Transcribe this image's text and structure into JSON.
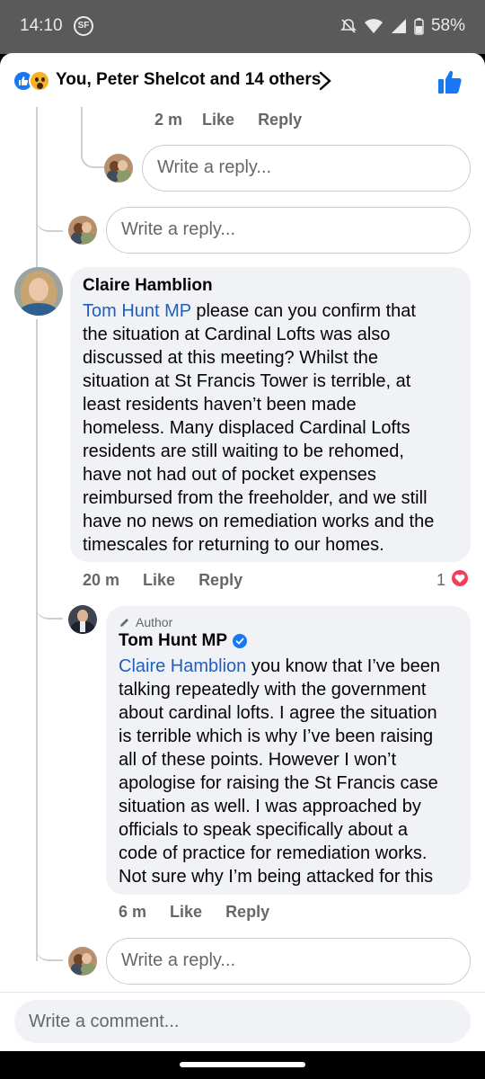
{
  "status_bar": {
    "time": "14:10",
    "sf_badge": "SF",
    "battery": "58%"
  },
  "reactions": {
    "summary": "You, Peter Shelcot and 14 others"
  },
  "thread_top": {
    "time": "2 m",
    "like": "Like",
    "reply": "Reply"
  },
  "reply_boxes": {
    "placeholder": "Write a reply..."
  },
  "comment_claire": {
    "author": "Claire Hamblion",
    "mention": "Tom Hunt MP",
    "lines": [
      "please can you confirm that",
      "the situation at Cardinal Lofts was also",
      "discussed at this meeting? Whilst the",
      "situation at St Francis Tower is terrible, at",
      "least residents haven’t been made",
      "homeless. Many displaced Cardinal Lofts",
      "residents are still waiting to be rehomed,",
      "have not had out of pocket expenses",
      "reimbursed from the freeholder, and we still",
      "have no news on remediation works and the",
      "timescales for returning to our homes."
    ],
    "time": "20 m",
    "like": "Like",
    "reply": "Reply",
    "reaction_count": "1"
  },
  "comment_tom": {
    "badge": "Author",
    "author": "Tom Hunt MP",
    "mention": "Claire Hamblion",
    "lines": [
      "you know that I’ve been",
      "talking repeatedly with the government",
      "about cardinal lofts. I agree the situation",
      "is terrible which is why I’ve been raising",
      "all of these points. However I won’t",
      "apologise for raising the St Francis case",
      "situation as well. I was approached by",
      "officials to speak specifically about a",
      "code of practice for remediation works.",
      "Not sure why I’m being attacked for this"
    ],
    "time": "6 m",
    "like": "Like",
    "reply": "Reply"
  },
  "composer": {
    "placeholder": "Write a comment..."
  },
  "colors": {
    "link": "#1f5fc1",
    "like_blue": "#1877f2",
    "heart": "#f33e58"
  }
}
